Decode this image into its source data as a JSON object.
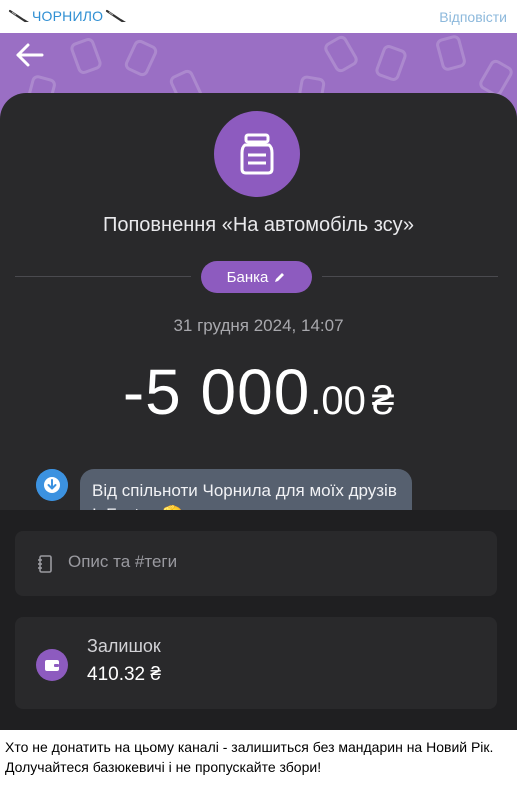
{
  "post": {
    "channel_name": "ЧОРНИЛО",
    "reply_label": "Відповісти",
    "caption_line1": "Хто не донатить на цьому каналі - залишиться без мандарин на Новий Рік.",
    "caption_line2": "Долучайтеся базюкевичі і не пропускайте збори!"
  },
  "transaction": {
    "title": "Поповнення «На автомобіль зсу»",
    "category_label": "Банка",
    "date": "31 грудня 2024, 14:07",
    "amount_main": "-5 000",
    "amount_cents": ".00",
    "currency": "₴",
    "comment": "Від спільноти Чорнила для моїх друзів InFactum",
    "comment_emoji": "🫡"
  },
  "details": {
    "notes_label": "Опис та #теги",
    "balance_label": "Залишок",
    "balance_value": "410.32 ₴"
  },
  "icons": {
    "back": "arrow-left-icon",
    "jar": "jar-icon",
    "pencil": "pencil-icon",
    "comment": "download-arrow-icon",
    "notes": "notebook-icon",
    "wallet": "wallet-icon",
    "channel_emoji": "fountain-pen-icon"
  },
  "colors": {
    "accent_purple": "#8d5bbf",
    "link_blue": "#2f8fd3",
    "card_bg": "#29292b"
  }
}
